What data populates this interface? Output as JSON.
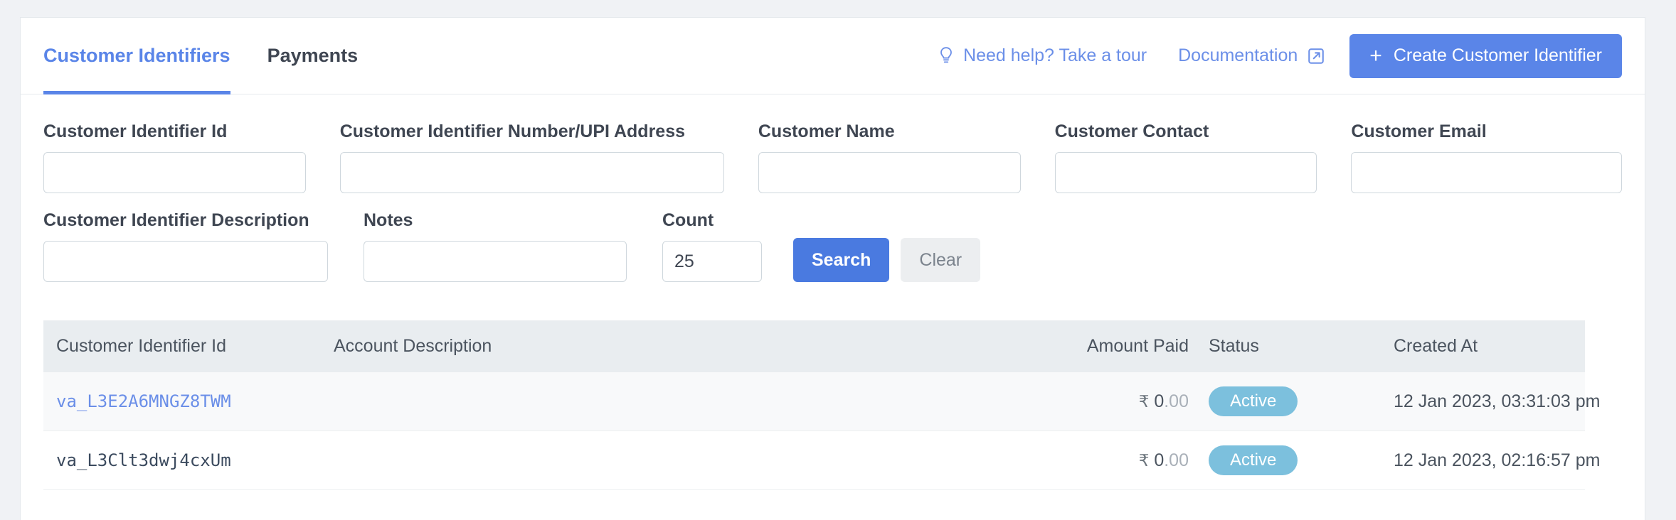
{
  "tabs": [
    {
      "label": "Customer Identifiers",
      "active": true
    },
    {
      "label": "Payments",
      "active": false
    }
  ],
  "header_actions": {
    "help_link": "Need help? Take a tour",
    "help_icon": "lightbulb-icon",
    "documentation_link": "Documentation",
    "documentation_icon": "external-link-icon",
    "create_button": "Create Customer Identifier",
    "create_button_icon": "plus-icon"
  },
  "filters": {
    "row1": [
      {
        "label": "Customer Identifier Id",
        "value": "",
        "placeholder": ""
      },
      {
        "label": "Customer Identifier Number/UPI Address",
        "value": "",
        "placeholder": ""
      },
      {
        "label": "Customer Name",
        "value": "",
        "placeholder": ""
      },
      {
        "label": "Customer Contact",
        "value": "",
        "placeholder": ""
      },
      {
        "label": "Customer Email",
        "value": "",
        "placeholder": ""
      }
    ],
    "row2": [
      {
        "label": "Customer Identifier Description",
        "value": "",
        "placeholder": ""
      },
      {
        "label": "Notes",
        "value": "",
        "placeholder": ""
      },
      {
        "label": "Count",
        "value": "25",
        "placeholder": ""
      }
    ],
    "search_button": "Search",
    "clear_button": "Clear"
  },
  "table": {
    "columns": [
      "Customer Identifier Id",
      "Account Description",
      "Amount Paid",
      "Status",
      "Created At"
    ],
    "rows": [
      {
        "identifier": "va_L3E2A6MNGZ8TWM",
        "description": "",
        "amount_currency": "₹",
        "amount_int": "0",
        "amount_dec": ".00",
        "status": "Active",
        "created_at": "12 Jan 2023, 03:31:03 pm"
      },
      {
        "identifier": "va_L3Clt3dwj4cxUm",
        "description": "",
        "amount_currency": "₹",
        "amount_int": "0",
        "amount_dec": ".00",
        "status": "Active",
        "created_at": "12 Jan 2023, 02:16:57 pm"
      }
    ]
  },
  "colors": {
    "accent": "#5a85e8",
    "status_badge": "#7cc0dd",
    "page_bg": "#f0f2f5",
    "header_bg": "#e9edf0"
  }
}
